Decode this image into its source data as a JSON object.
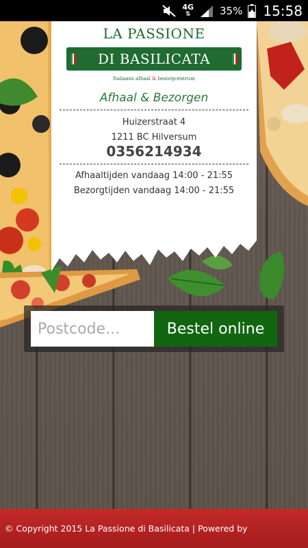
{
  "status_bar": {
    "network": "4G",
    "battery_percent": "35%",
    "time": "15:58",
    "icons": [
      "mute-icon",
      "signal-icon",
      "battery-icon"
    ]
  },
  "logo": {
    "line1": "LA PASSIONE",
    "line2": "DI BASILICATA",
    "tagline_part1": "Italiaans afhaal ",
    "tagline_amp": "&",
    "tagline_part2": " bezorgcentrum"
  },
  "receipt": {
    "subtitle": "Afhaal & Bezorgen",
    "address_line1": "Huizerstraat 4",
    "address_line2": "1211 BC Hilversum",
    "phone": "0356214934",
    "pickup_hours": "Afhaaltijden vandaag 14:00 - 21:55",
    "delivery_hours": "Bezorgtijden vandaag 14:00 - 21:55"
  },
  "order": {
    "postcode_placeholder": "Postcode...",
    "postcode_value": "",
    "button_label": "Bestel online"
  },
  "footer": {
    "text": "© Copyright 2015 La Passione di Basilicata | Powered by"
  },
  "colors": {
    "brand_green": "#1f6b31",
    "button_green": "#11660f",
    "footer_red": "#b22222",
    "italian_red": "#c8202a"
  }
}
